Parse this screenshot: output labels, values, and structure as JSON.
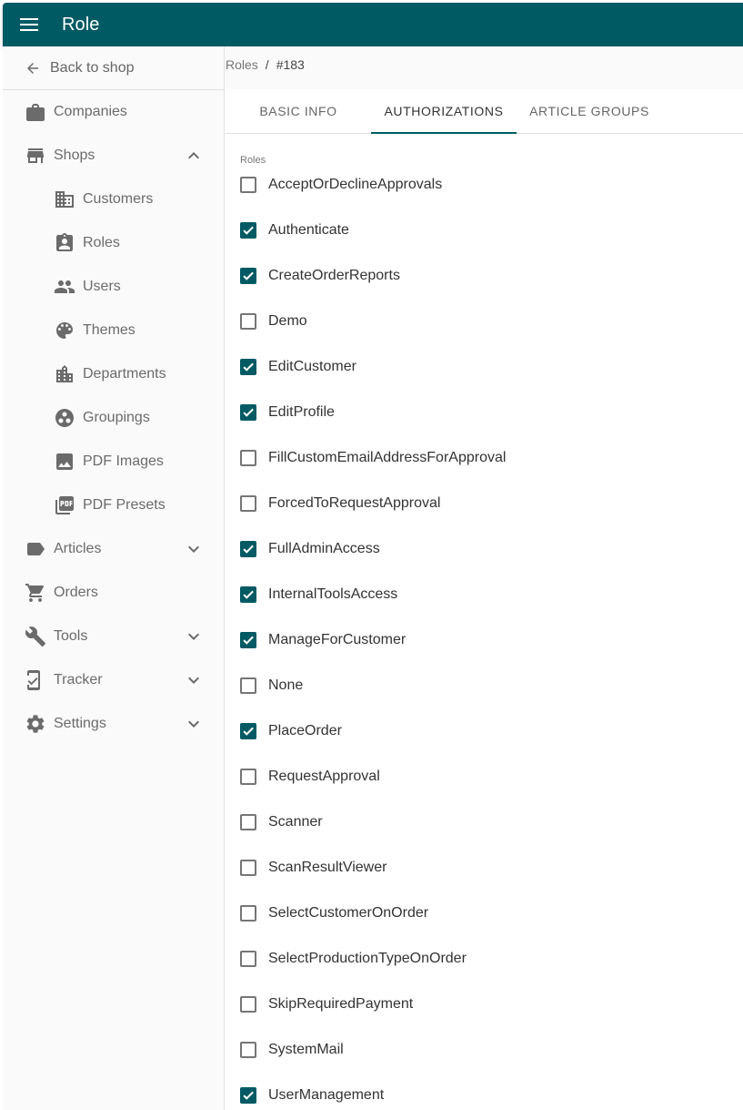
{
  "appbar": {
    "title": "Role",
    "menu_icon": "menu-icon"
  },
  "sidebar": {
    "back_label": "Back to shop",
    "items": [
      {
        "key": "companies",
        "label": "Companies",
        "icon": "briefcase-icon",
        "sub": false,
        "chevron": ""
      },
      {
        "key": "shops",
        "label": "Shops",
        "icon": "store-icon",
        "sub": false,
        "chevron": "up"
      },
      {
        "key": "customers",
        "label": "Customers",
        "icon": "building-icon",
        "sub": true,
        "chevron": ""
      },
      {
        "key": "roles",
        "label": "Roles",
        "icon": "badge-icon",
        "sub": true,
        "chevron": ""
      },
      {
        "key": "users",
        "label": "Users",
        "icon": "people-icon",
        "sub": true,
        "chevron": ""
      },
      {
        "key": "themes",
        "label": "Themes",
        "icon": "palette-icon",
        "sub": true,
        "chevron": ""
      },
      {
        "key": "departments",
        "label": "Departments",
        "icon": "city-icon",
        "sub": true,
        "chevron": ""
      },
      {
        "key": "groupings",
        "label": "Groupings",
        "icon": "workspaces-icon",
        "sub": true,
        "chevron": ""
      },
      {
        "key": "pdf-images",
        "label": "PDF Images",
        "icon": "image-icon",
        "sub": true,
        "chevron": ""
      },
      {
        "key": "pdf-presets",
        "label": "PDF Presets",
        "icon": "pdf-icon",
        "sub": true,
        "chevron": ""
      },
      {
        "key": "articles",
        "label": "Articles",
        "icon": "label-icon",
        "sub": false,
        "chevron": "down"
      },
      {
        "key": "orders",
        "label": "Orders",
        "icon": "cart-icon",
        "sub": false,
        "chevron": ""
      },
      {
        "key": "tools",
        "label": "Tools",
        "icon": "wrench-icon",
        "sub": false,
        "chevron": "down"
      },
      {
        "key": "tracker",
        "label": "Tracker",
        "icon": "phone-check-icon",
        "sub": false,
        "chevron": "down"
      },
      {
        "key": "settings",
        "label": "Settings",
        "icon": "gear-icon",
        "sub": false,
        "chevron": "down"
      }
    ]
  },
  "breadcrumb": {
    "parent": "Roles",
    "separator": "/",
    "current": "#183"
  },
  "tabs": [
    {
      "key": "basic",
      "label": "BASIC INFO",
      "active": false
    },
    {
      "key": "auth",
      "label": "AUTHORIZATIONS",
      "active": true
    },
    {
      "key": "art",
      "label": "ARTICLE GROUPS",
      "active": false
    }
  ],
  "roles_label": "Roles",
  "roles": [
    {
      "label": "AcceptOrDeclineApprovals",
      "checked": false
    },
    {
      "label": "Authenticate",
      "checked": true
    },
    {
      "label": "CreateOrderReports",
      "checked": true
    },
    {
      "label": "Demo",
      "checked": false
    },
    {
      "label": "EditCustomer",
      "checked": true
    },
    {
      "label": "EditProfile",
      "checked": true
    },
    {
      "label": "FillCustomEmailAddressForApproval",
      "checked": false
    },
    {
      "label": "ForcedToRequestApproval",
      "checked": false
    },
    {
      "label": "FullAdminAccess",
      "checked": true
    },
    {
      "label": "InternalToolsAccess",
      "checked": true
    },
    {
      "label": "ManageForCustomer",
      "checked": true
    },
    {
      "label": "None",
      "checked": false
    },
    {
      "label": "PlaceOrder",
      "checked": true
    },
    {
      "label": "RequestApproval",
      "checked": false
    },
    {
      "label": "Scanner",
      "checked": false
    },
    {
      "label": "ScanResultViewer",
      "checked": false
    },
    {
      "label": "SelectCustomerOnOrder",
      "checked": false
    },
    {
      "label": "SelectProductionTypeOnOrder",
      "checked": false
    },
    {
      "label": "SkipRequiredPayment",
      "checked": false
    },
    {
      "label": "SystemMail",
      "checked": false
    },
    {
      "label": "UserManagement",
      "checked": true
    }
  ],
  "colors": {
    "primary": "#005a63",
    "icon": "#6b6b6b"
  }
}
